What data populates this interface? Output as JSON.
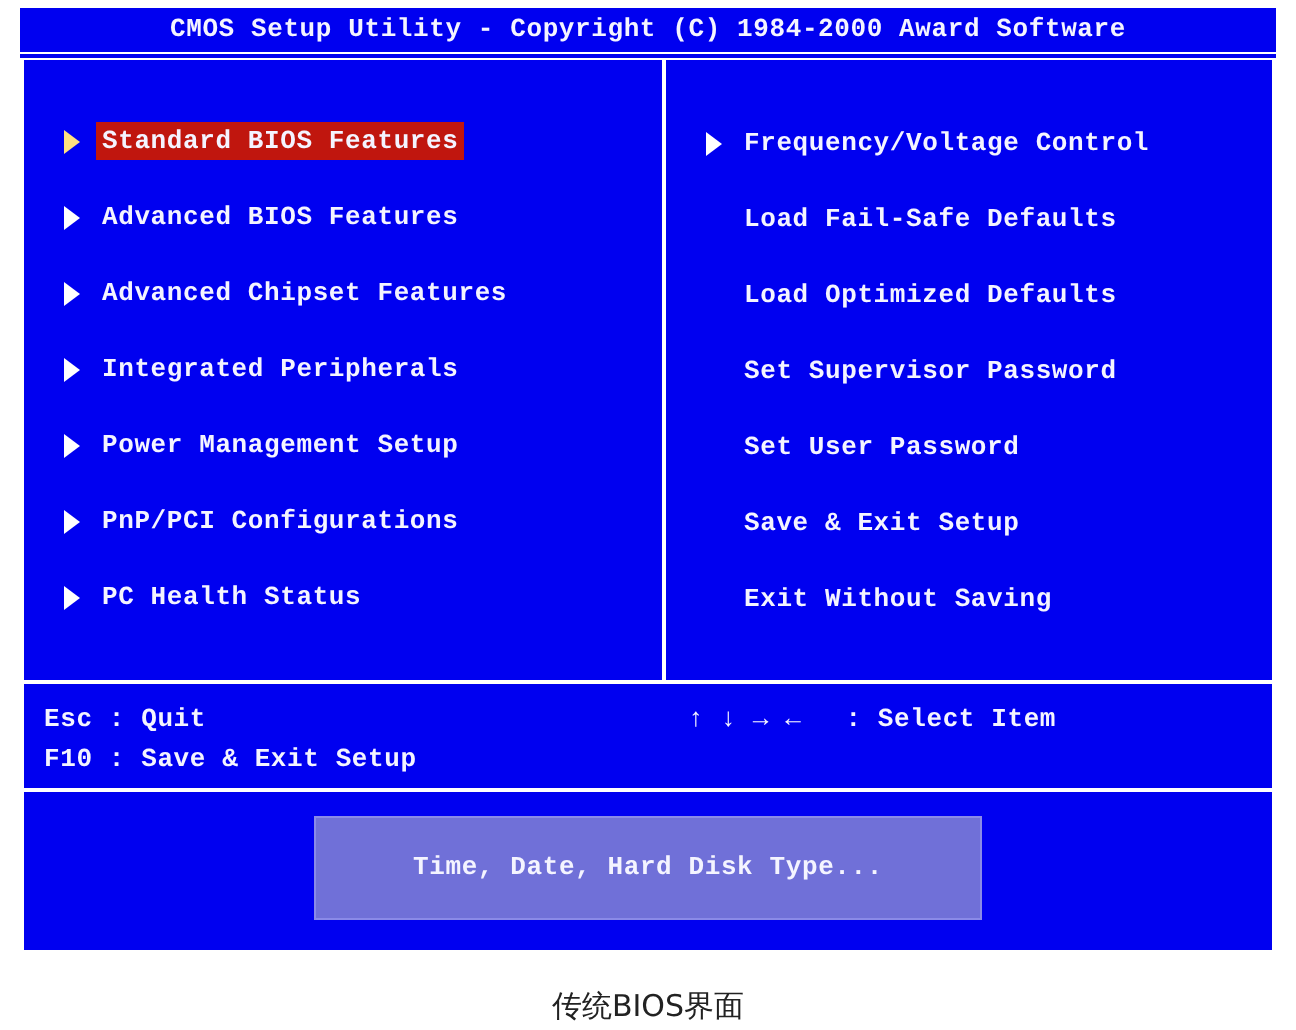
{
  "title": "CMOS Setup Utility - Copyright (C) 1984-2000 Award Software",
  "left_menu": [
    {
      "label": "Standard BIOS Features",
      "kind": "submenu",
      "selected": true
    },
    {
      "label": "Advanced BIOS Features",
      "kind": "submenu",
      "selected": false
    },
    {
      "label": "Advanced Chipset Features",
      "kind": "submenu",
      "selected": false
    },
    {
      "label": "Integrated Peripherals",
      "kind": "submenu",
      "selected": false
    },
    {
      "label": "Power Management Setup",
      "kind": "submenu",
      "selected": false
    },
    {
      "label": "PnP/PCI Configurations",
      "kind": "submenu",
      "selected": false
    },
    {
      "label": "PC Health Status",
      "kind": "submenu",
      "selected": false
    }
  ],
  "right_menu": [
    {
      "label": "Frequency/Voltage Control",
      "kind": "submenu",
      "selected": false
    },
    {
      "label": "Load Fail-Safe Defaults",
      "kind": "action",
      "selected": false
    },
    {
      "label": "Load Optimized Defaults",
      "kind": "action",
      "selected": false
    },
    {
      "label": "Set Supervisor Password",
      "kind": "action",
      "selected": false
    },
    {
      "label": "Set User Password",
      "kind": "action",
      "selected": false
    },
    {
      "label": "Save & Exit Setup",
      "kind": "action",
      "selected": false
    },
    {
      "label": "Exit Without Saving",
      "kind": "action",
      "selected": false
    }
  ],
  "help_left": [
    "Esc : Quit",
    "F10 : Save & Exit Setup"
  ],
  "help_right": {
    "keys": "↑ ↓ → ←",
    "action": ": Select Item"
  },
  "description": "Time, Date, Hard Disk Type...",
  "caption": "传统BIOS界面"
}
